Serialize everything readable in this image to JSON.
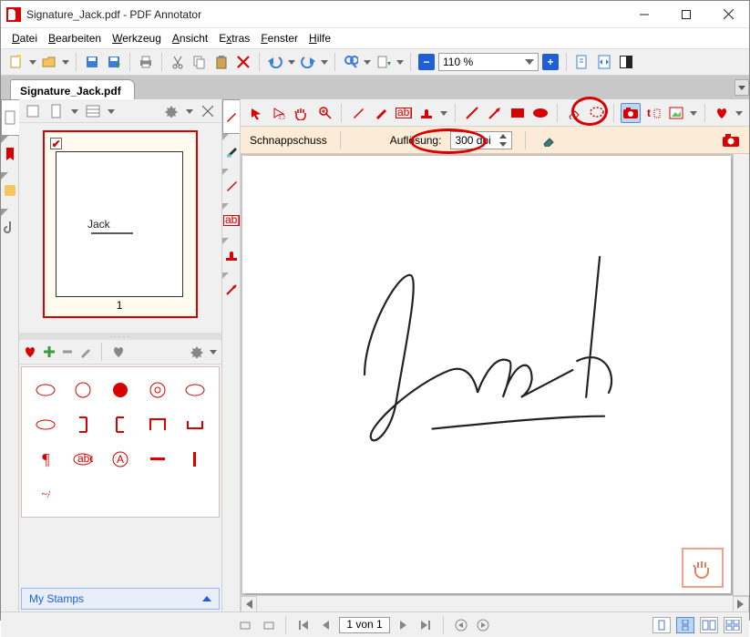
{
  "window": {
    "title": "Signature_Jack.pdf - PDF Annotator"
  },
  "menu": {
    "datei": "Datei",
    "bearbeiten": "Bearbeiten",
    "werkzeug": "Werkzeug",
    "ansicht": "Ansicht",
    "extras": "Extras",
    "fenster": "Fenster",
    "hilfe": "Hilfe"
  },
  "zoom": {
    "value": "110 %"
  },
  "tab": {
    "name": "Signature_Jack.pdf"
  },
  "thumb": {
    "page_num": "1",
    "sig_small": "Jack"
  },
  "anno2": {
    "snapshot": "Schnappschuss",
    "resolution_label": "Auflösung:",
    "dpi": "300 dpi"
  },
  "fav": {
    "cat": "My Stamps"
  },
  "status": {
    "page": "1 von 1"
  },
  "signature": "Jack"
}
